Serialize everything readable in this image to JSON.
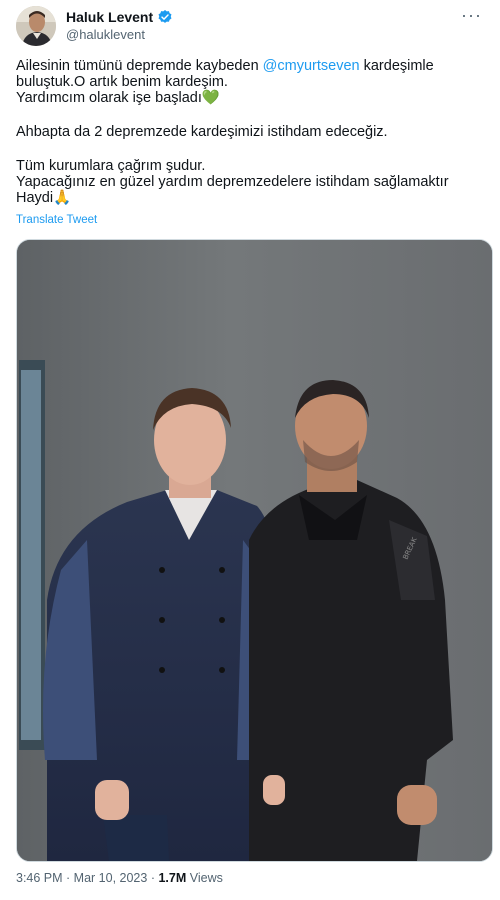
{
  "author": {
    "display_name": "Haluk Levent",
    "handle": "@haluklevent",
    "verified_color": "#1d9bf0"
  },
  "tweet": {
    "line1_pre": "Ailesinin tümünü depremde kaybeden ",
    "line1_mention": "@cmyurtseven",
    "line1_post": " kardeşimle",
    "line2": "buluştuk.O artık benim kardeşim.",
    "line3": "Yardımcım olarak işe başladı",
    "line3_emoji": "💚",
    "line4": "Ahbapta da 2 depremzede kardeşimizi istihdam edeceğiz.",
    "line5": "Tüm kurumlara çağrım şudur.",
    "line6": "Yapacağınız en güzel yardım depremzedelere istihdam sağlamaktır",
    "line7": "Haydi",
    "line7_emoji": "🙏",
    "translate_label": "Translate Tweet"
  },
  "meta": {
    "time": "3:46 PM",
    "separator": " · ",
    "date": "Mar 10, 2023",
    "views_count": "1.7M",
    "views_label": " Views"
  },
  "icons": {
    "more": "more-horizontal-icon",
    "verified": "verified-badge-icon"
  },
  "colors": {
    "accent": "#1d9bf0",
    "secondary_text": "#536471",
    "primary_text": "#0f1419"
  }
}
